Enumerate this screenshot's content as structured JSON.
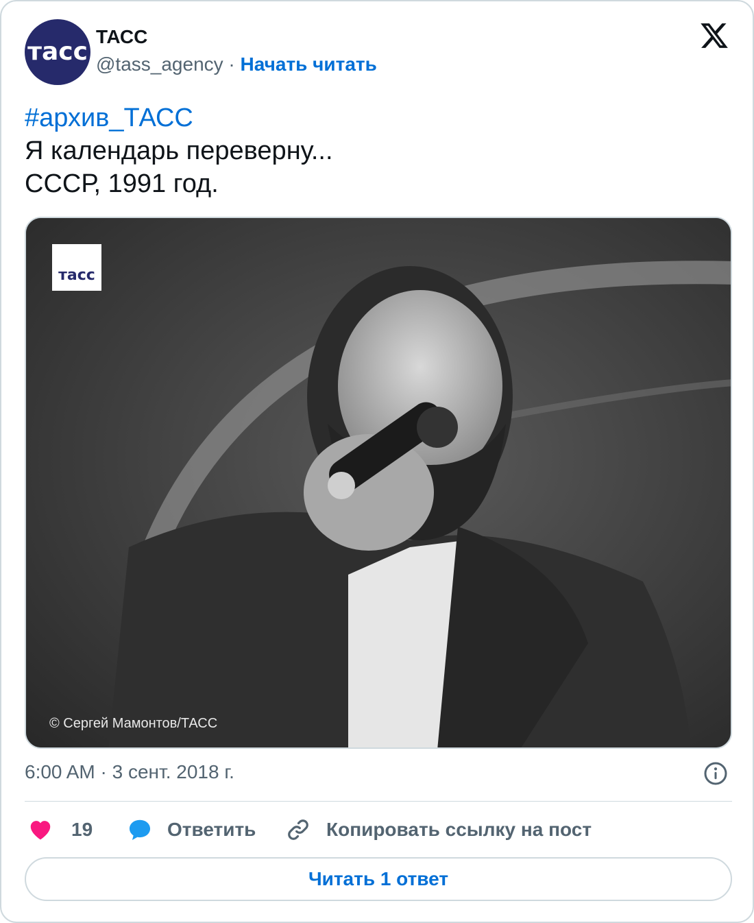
{
  "author": {
    "avatar_text": "тасс",
    "name": "ТАСС",
    "handle": "@tass_agency",
    "separator": "·",
    "follow_label": "Начать читать"
  },
  "tweet": {
    "hashtag": "#архив_ТАСС",
    "line1": "Я календарь переверну...",
    "line2": "СССР, 1991 год."
  },
  "photo": {
    "badge_text": "тасс",
    "credit": "© Сергей Мамонтов/ТАСС"
  },
  "meta": {
    "timestamp": "6:00 AM · 3 сент. 2018 г."
  },
  "actions": {
    "like_count": "19",
    "reply_label": "Ответить",
    "copy_label": "Копировать ссылку на пост"
  },
  "read_replies_label": "Читать 1 ответ",
  "colors": {
    "link": "#006fd6",
    "like": "#f91880",
    "reply": "#1d9bf0",
    "border": "#cfd9de",
    "muted": "#536471"
  },
  "icons": [
    "x-logo-icon",
    "info-icon",
    "heart-icon",
    "speech-bubble-icon",
    "link-icon"
  ]
}
